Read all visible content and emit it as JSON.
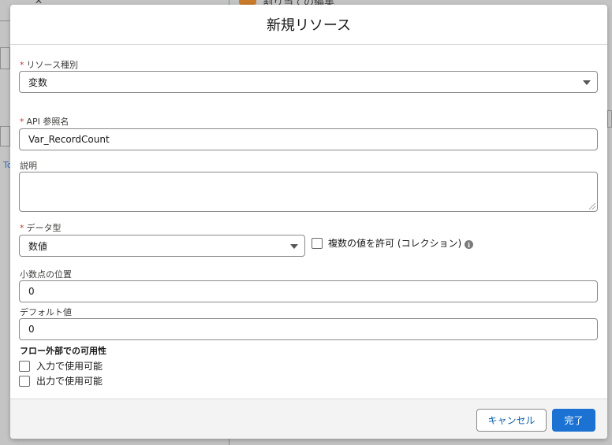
{
  "background": {
    "header_text": "割り当ての編集",
    "side_link": "To"
  },
  "modal": {
    "title": "新規リソース",
    "resource_type": {
      "label": "リソース種別",
      "value": "変数"
    },
    "api_name": {
      "label": "API 参照名",
      "value": "Var_RecordCount"
    },
    "description": {
      "label": "説明",
      "value": ""
    },
    "data_type": {
      "label": "データ型",
      "value": "数値"
    },
    "allow_multiple": {
      "label": "複数の値を許可 (コレクション)",
      "checked": false,
      "info_icon": "i"
    },
    "decimal_places": {
      "label": "小数点の位置",
      "value": "0"
    },
    "default_value": {
      "label": "デフォルト値",
      "value": "0"
    },
    "availability": {
      "title": "フロー外部での可用性",
      "input": {
        "label": "入力で使用可能",
        "checked": false
      },
      "output": {
        "label": "出力で使用可能",
        "checked": false
      }
    },
    "required_marker": "*"
  },
  "footer": {
    "cancel_label": "キャンセル",
    "done_label": "完了"
  },
  "colors": {
    "brand": "#1b72d3",
    "required": "#c23934",
    "overlay": "#c4c4c4"
  }
}
